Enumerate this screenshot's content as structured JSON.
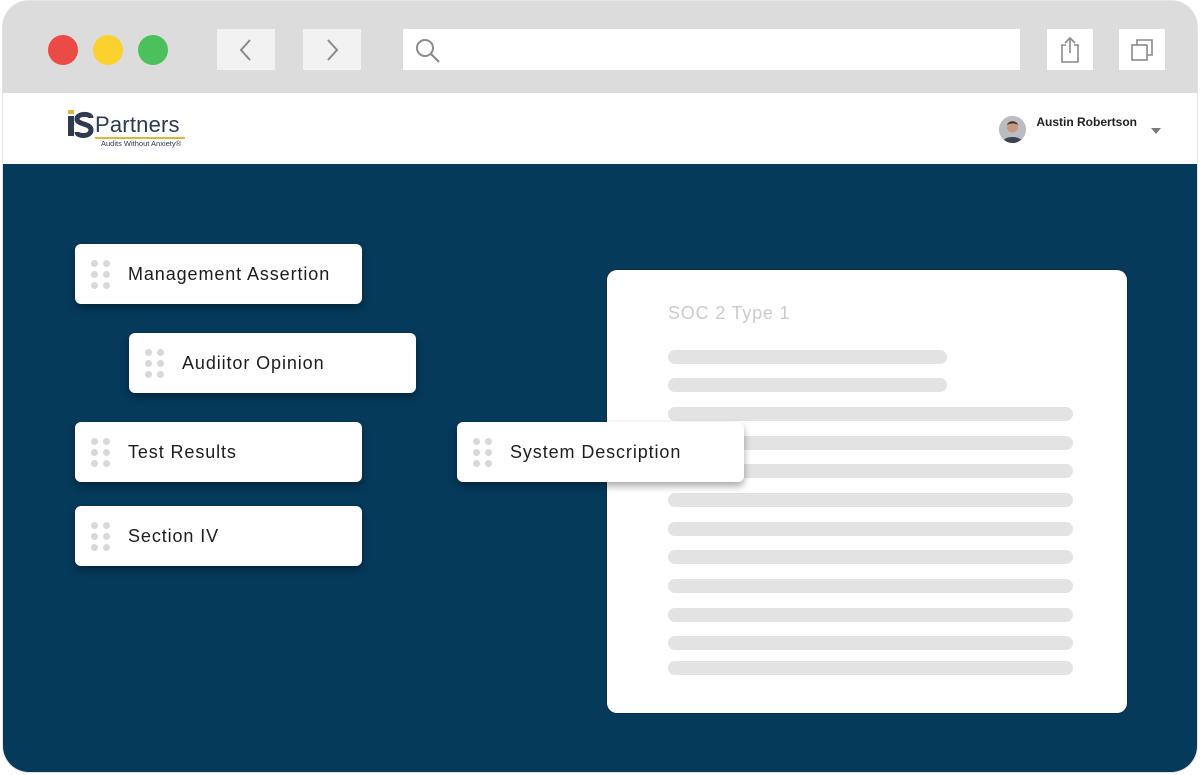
{
  "browser": {
    "controls": {
      "close_color": "#ec4a46",
      "minimize_color": "#fbd22d",
      "zoom_color": "#4cc05a"
    },
    "nav": {
      "back_icon": "chevron-left-icon",
      "forward_icon": "chevron-right-icon"
    },
    "address_bar": {
      "icon": "search-icon",
      "value": ""
    },
    "toolbar": {
      "share_icon": "share-icon",
      "tabs_icon": "tabs-icon"
    }
  },
  "header": {
    "logo": {
      "brand": "Partners",
      "tagline": "Audits Without Anxiety®"
    },
    "user": {
      "name": "Austin Robertson",
      "menu_icon": "caret-down-icon"
    }
  },
  "sections": [
    {
      "label": "Management Assertion"
    },
    {
      "label": "Audiitor Opinion"
    },
    {
      "label": "Test Results"
    },
    {
      "label": "Section IV"
    },
    {
      "label": "System Description"
    }
  ],
  "report": {
    "title": "SOC 2 Type 1"
  },
  "colors": {
    "main_background": "#053a5b",
    "card": "#ffffff",
    "placeholder_line": "#e3e3e3"
  }
}
